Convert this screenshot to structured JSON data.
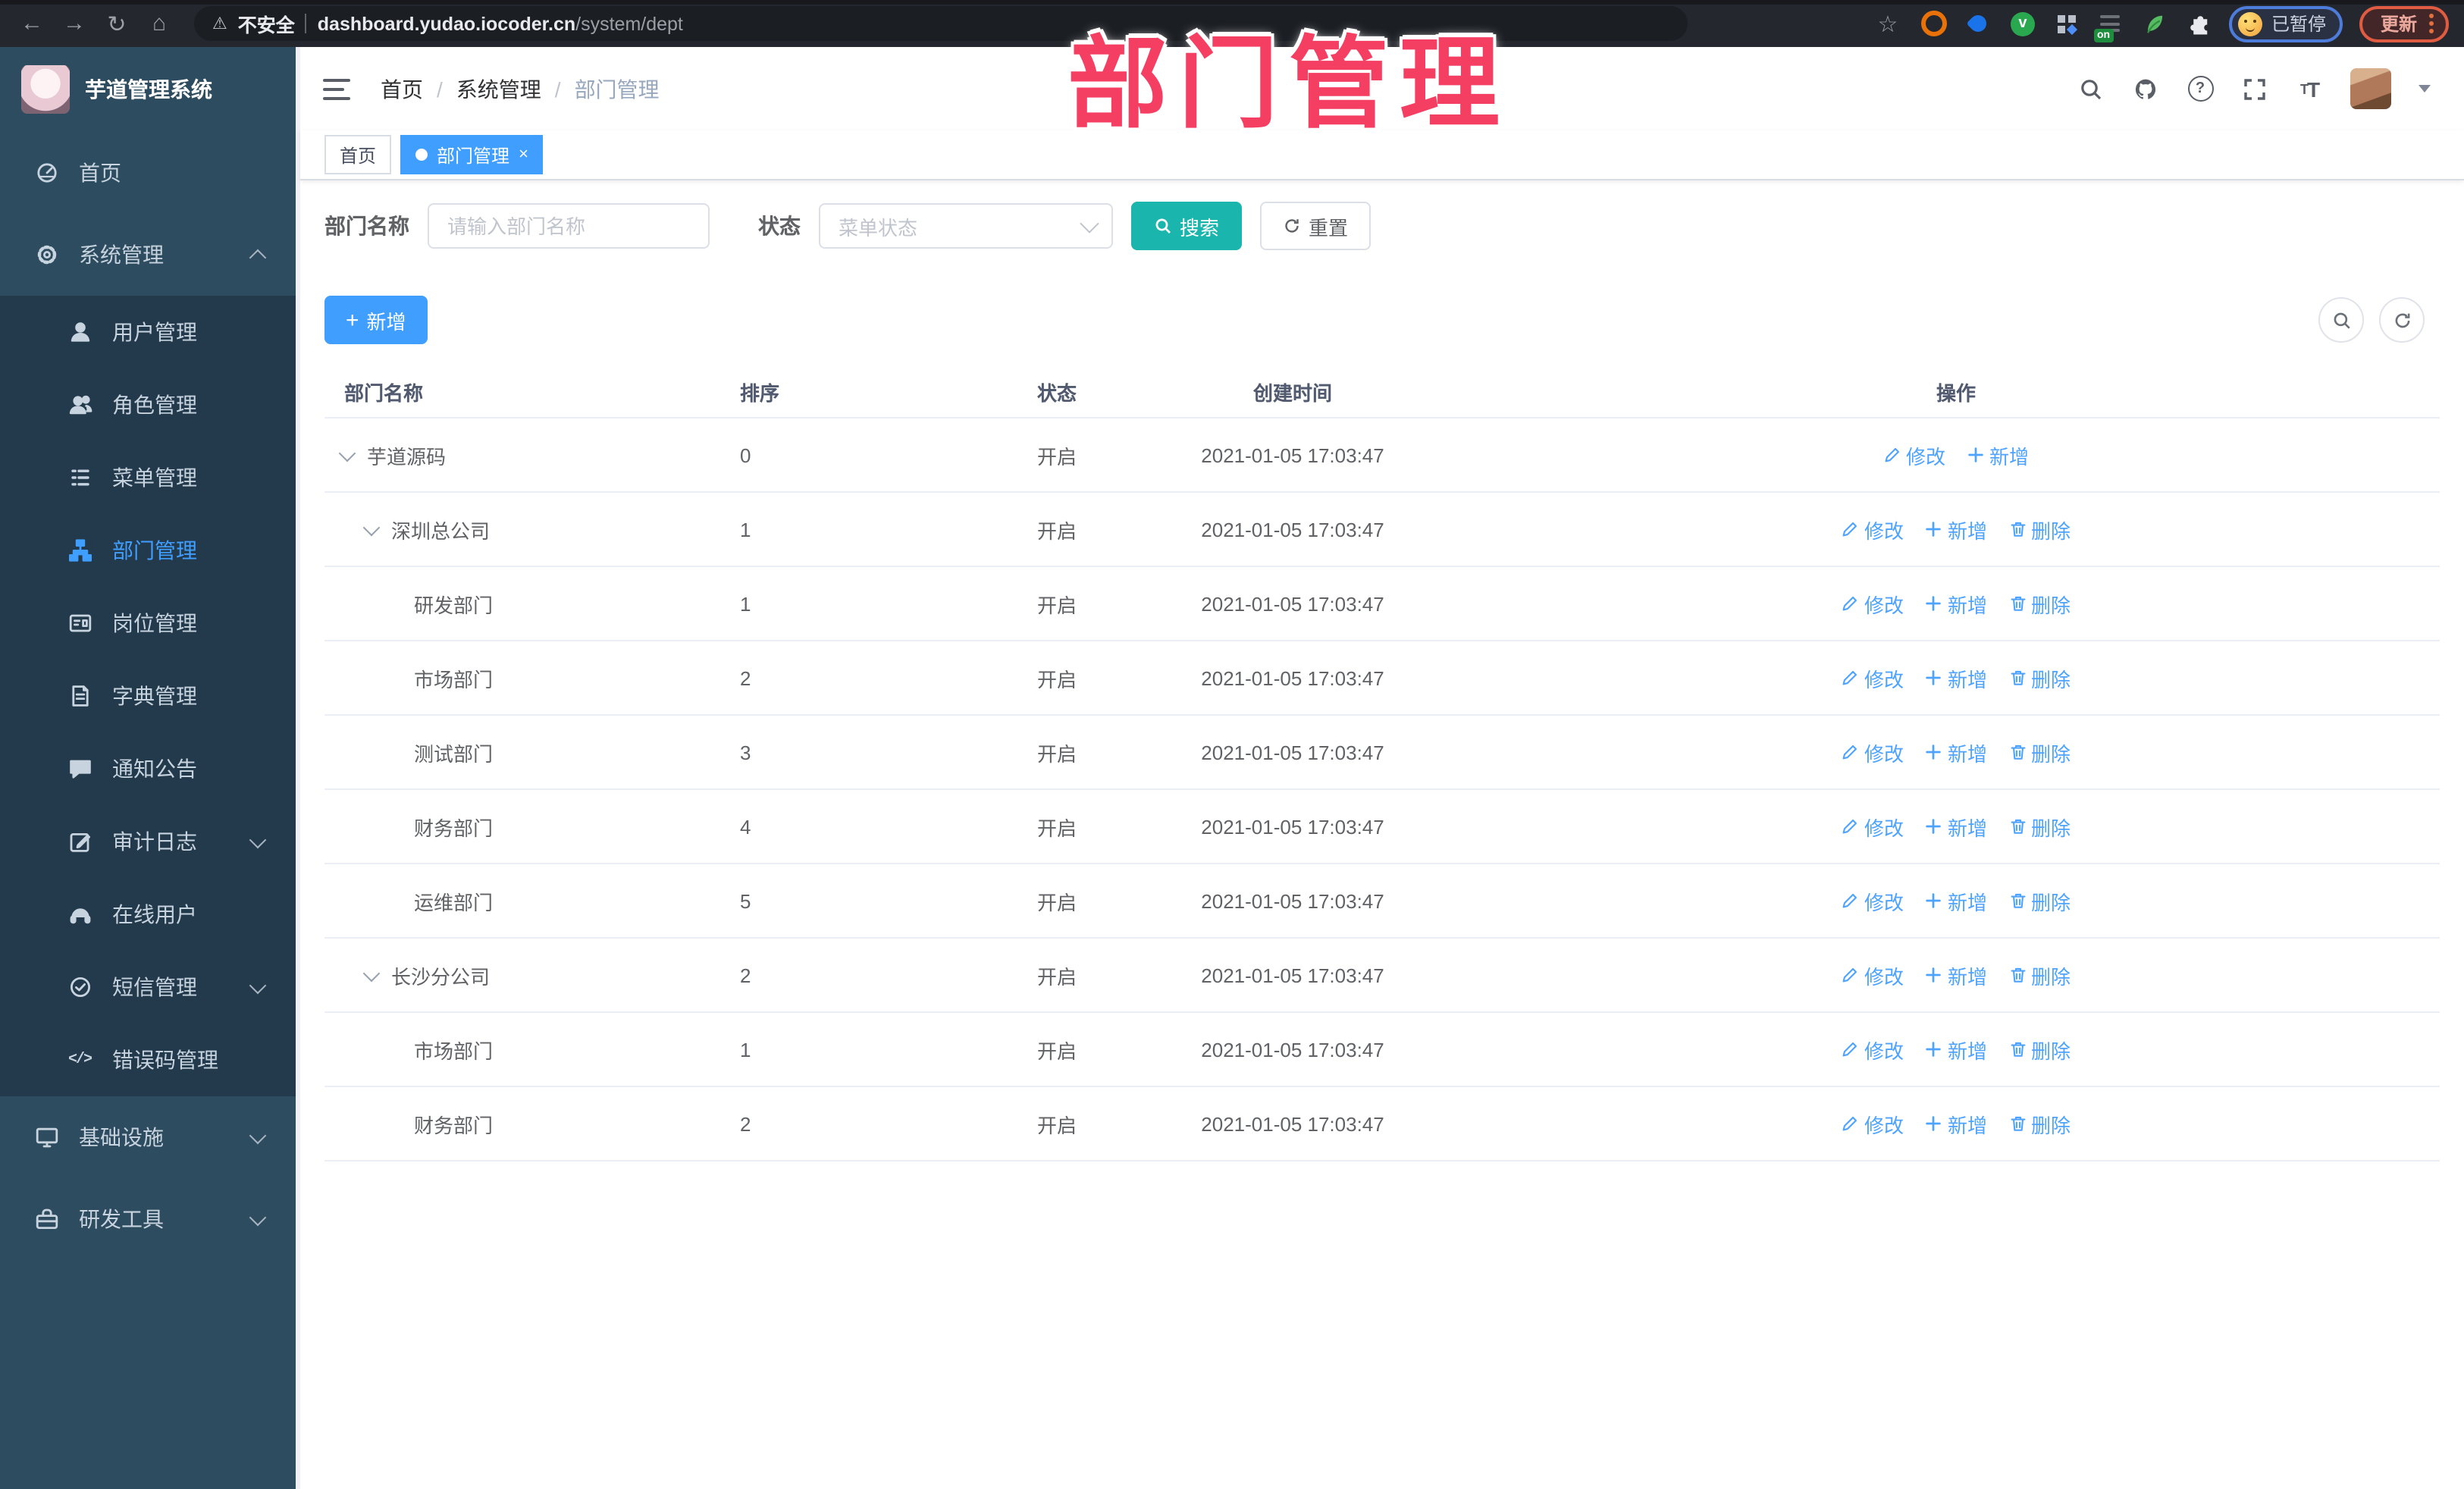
{
  "browser": {
    "security_label": "不安全",
    "url_host": "dashboard.yudao.iocoder.cn",
    "url_path": "/system/dept",
    "paused_label": "已暂停",
    "update_label": "更新",
    "ext_on_badge": "on",
    "extensions": [
      "target-icon",
      "drop-icon",
      "v-badge-icon",
      "grid-icon",
      "tabs-on-icon",
      "sprout-icon",
      "puzzle-icon"
    ]
  },
  "sidebar": {
    "title": "芋道管理系统",
    "items": [
      {
        "id": "home",
        "label": "首页",
        "icon": "dashboard-icon",
        "type": "root"
      },
      {
        "id": "system",
        "label": "系统管理",
        "icon": "gear-icon",
        "type": "root",
        "expanded": true,
        "chevron": "up"
      },
      {
        "id": "user",
        "label": "用户管理",
        "icon": "user-icon",
        "type": "sub"
      },
      {
        "id": "role",
        "label": "角色管理",
        "icon": "users-icon",
        "type": "sub"
      },
      {
        "id": "menu",
        "label": "菜单管理",
        "icon": "list-icon",
        "type": "sub"
      },
      {
        "id": "dept",
        "label": "部门管理",
        "icon": "org-tree-icon",
        "type": "sub",
        "active": true
      },
      {
        "id": "post",
        "label": "岗位管理",
        "icon": "id-card-icon",
        "type": "sub"
      },
      {
        "id": "dict",
        "label": "字典管理",
        "icon": "book-icon",
        "type": "sub"
      },
      {
        "id": "notice",
        "label": "通知公告",
        "icon": "megaphone-icon",
        "type": "sub"
      },
      {
        "id": "audit",
        "label": "审计日志",
        "icon": "edit-square-icon",
        "type": "sub",
        "chevron": "down"
      },
      {
        "id": "online",
        "label": "在线用户",
        "icon": "headset-icon",
        "type": "sub"
      },
      {
        "id": "sms",
        "label": "短信管理",
        "icon": "message-check-icon",
        "type": "sub",
        "chevron": "down"
      },
      {
        "id": "errcode",
        "label": "错误码管理",
        "icon": "code-icon",
        "type": "sub"
      },
      {
        "id": "infra",
        "label": "基础设施",
        "icon": "monitor-icon",
        "type": "root",
        "chevron": "down"
      },
      {
        "id": "devtools",
        "label": "研发工具",
        "icon": "toolbox-icon",
        "type": "root",
        "chevron": "down"
      }
    ]
  },
  "header": {
    "breadcrumb": [
      "首页",
      "系统管理",
      "部门管理"
    ]
  },
  "tabs": [
    {
      "label": "首页",
      "active": false
    },
    {
      "label": "部门管理",
      "active": true,
      "closable": true
    }
  ],
  "filters": {
    "name_label": "部门名称",
    "name_placeholder": "请输入部门名称",
    "status_label": "状态",
    "status_placeholder": "菜单状态",
    "search_label": "搜索",
    "reset_label": "重置"
  },
  "toolbar": {
    "add_label": "新增"
  },
  "table": {
    "columns": [
      "部门名称",
      "排序",
      "状态",
      "创建时间",
      "操作"
    ],
    "action_labels": {
      "modify": "修改",
      "add": "新增",
      "delete": "删除"
    },
    "rows": [
      {
        "level": 0,
        "caret": true,
        "name": "芋道源码",
        "sort": "0",
        "status": "开启",
        "created": "2021-01-05 17:03:47",
        "actions": [
          "modify",
          "add"
        ]
      },
      {
        "level": 1,
        "caret": true,
        "name": "深圳总公司",
        "sort": "1",
        "status": "开启",
        "created": "2021-01-05 17:03:47",
        "actions": [
          "modify",
          "add",
          "delete"
        ]
      },
      {
        "level": 2,
        "caret": false,
        "name": "研发部门",
        "sort": "1",
        "status": "开启",
        "created": "2021-01-05 17:03:47",
        "actions": [
          "modify",
          "add",
          "delete"
        ]
      },
      {
        "level": 2,
        "caret": false,
        "name": "市场部门",
        "sort": "2",
        "status": "开启",
        "created": "2021-01-05 17:03:47",
        "actions": [
          "modify",
          "add",
          "delete"
        ]
      },
      {
        "level": 2,
        "caret": false,
        "name": "测试部门",
        "sort": "3",
        "status": "开启",
        "created": "2021-01-05 17:03:47",
        "actions": [
          "modify",
          "add",
          "delete"
        ]
      },
      {
        "level": 2,
        "caret": false,
        "name": "财务部门",
        "sort": "4",
        "status": "开启",
        "created": "2021-01-05 17:03:47",
        "actions": [
          "modify",
          "add",
          "delete"
        ]
      },
      {
        "level": 2,
        "caret": false,
        "name": "运维部门",
        "sort": "5",
        "status": "开启",
        "created": "2021-01-05 17:03:47",
        "actions": [
          "modify",
          "add",
          "delete"
        ]
      },
      {
        "level": 1,
        "caret": true,
        "name": "长沙分公司",
        "sort": "2",
        "status": "开启",
        "created": "2021-01-05 17:03:47",
        "actions": [
          "modify",
          "add",
          "delete"
        ]
      },
      {
        "level": 2,
        "caret": false,
        "name": "市场部门",
        "sort": "1",
        "status": "开启",
        "created": "2021-01-05 17:03:47",
        "actions": [
          "modify",
          "add",
          "delete"
        ]
      },
      {
        "level": 2,
        "caret": false,
        "name": "财务部门",
        "sort": "2",
        "status": "开启",
        "created": "2021-01-05 17:03:47",
        "actions": [
          "modify",
          "add",
          "delete"
        ]
      }
    ]
  },
  "annotation": {
    "text": "部门管理"
  }
}
